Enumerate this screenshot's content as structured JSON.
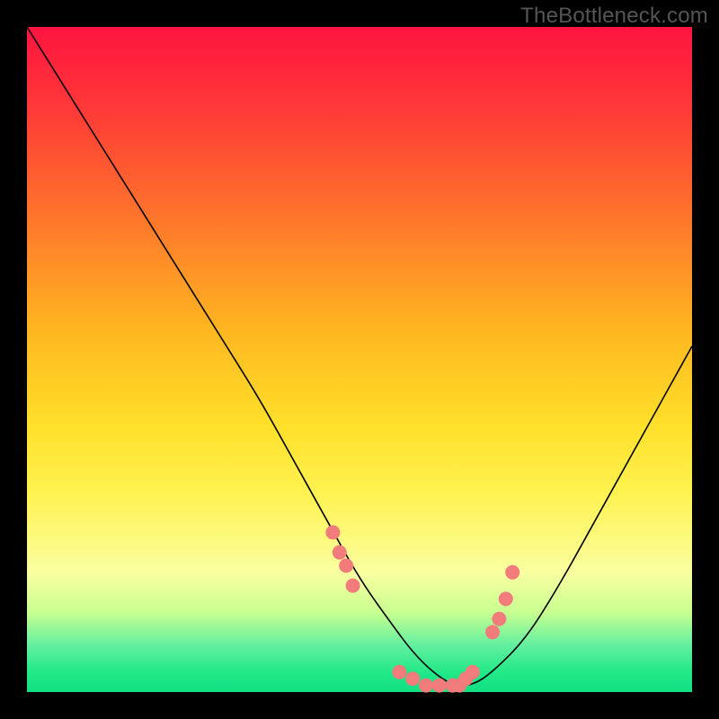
{
  "watermark": "TheBottleneck.com",
  "chart_data": {
    "type": "line",
    "title": "",
    "xlabel": "",
    "ylabel": "",
    "xlim": [
      0,
      100
    ],
    "ylim": [
      0,
      100
    ],
    "gradient_meaning": "red=high bottleneck, green=low bottleneck",
    "series": [
      {
        "name": "bottleneck-curve",
        "x": [
          0,
          5,
          10,
          15,
          20,
          25,
          30,
          35,
          40,
          45,
          50,
          55,
          58,
          61,
          64,
          67,
          70,
          75,
          80,
          85,
          90,
          95,
          100
        ],
        "y": [
          100,
          92,
          84,
          76,
          68,
          60,
          52,
          44,
          35,
          26,
          17,
          10,
          6,
          3,
          1,
          1,
          3,
          8,
          16,
          25,
          34,
          43,
          52
        ]
      }
    ],
    "scatter": {
      "name": "sample-points",
      "color": "#f27b7b",
      "x": [
        46,
        47,
        48,
        49,
        56,
        58,
        60,
        62,
        64,
        65,
        66,
        67,
        70,
        71,
        72,
        73
      ],
      "y": [
        24,
        21,
        19,
        16,
        3,
        2,
        1,
        1,
        1,
        1,
        2,
        3,
        9,
        11,
        14,
        18
      ]
    }
  }
}
